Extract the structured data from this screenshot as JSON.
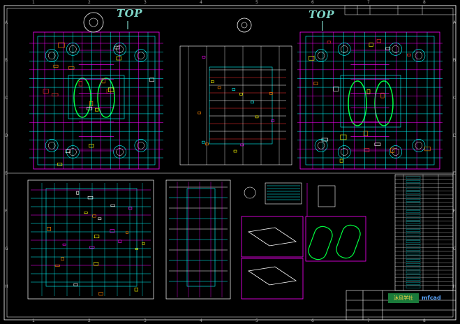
{
  "view": {
    "top_label_left": "TOP",
    "top_label_right": "TOP"
  },
  "border": {
    "row_markers": [
      "A",
      "B",
      "C",
      "D",
      "E",
      "F",
      "G",
      "H"
    ],
    "col_markers": [
      "1",
      "2",
      "3",
      "4",
      "5",
      "6",
      "7",
      "8"
    ]
  },
  "title_block": {
    "stamp_left": "沐风学社",
    "stamp_right": "mfcad"
  },
  "colors": {
    "background": "#000000",
    "frame": "#ffffff",
    "cyan": "#00ffff",
    "magenta": "#ff00ff",
    "green": "#00ff40",
    "yellow": "#ffff00",
    "red": "#ff3030",
    "orange": "#ff8800",
    "white": "#ffffff"
  }
}
